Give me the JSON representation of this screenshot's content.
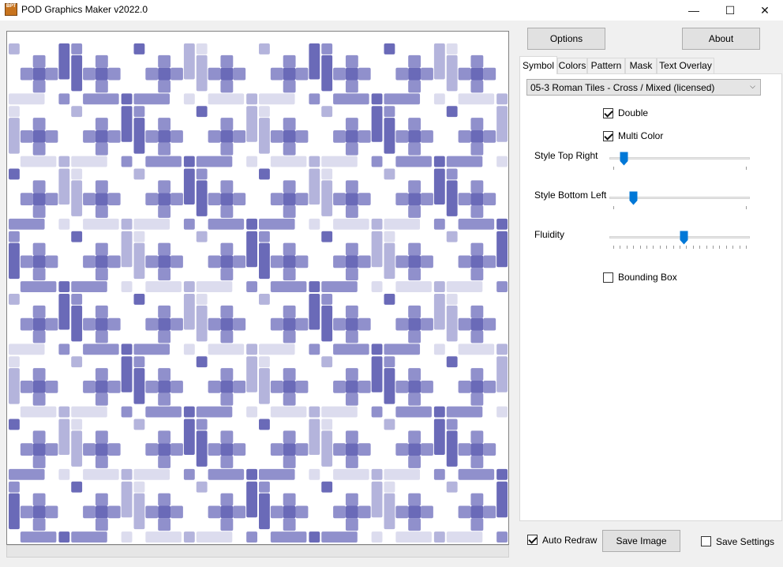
{
  "window": {
    "title": "POD Graphics Maker v2022.0",
    "app_icon_text": "BPT",
    "controls": {
      "minimize": "—",
      "maximize": "☐",
      "close": "✕"
    }
  },
  "toolbar": {
    "options_label": "Options",
    "about_label": "About"
  },
  "tabs": [
    {
      "label": "Symbol",
      "active": true
    },
    {
      "label": "Colors",
      "active": false
    },
    {
      "label": "Pattern",
      "active": false
    },
    {
      "label": "Mask",
      "active": false
    },
    {
      "label": "Text Overlay",
      "active": false
    }
  ],
  "symbol_tab": {
    "symbol_select": "05-3 Roman Tiles - Cross / Mixed (licensed)",
    "double": {
      "label": "Double",
      "checked": true
    },
    "multi_color": {
      "label": "Multi Color",
      "checked": true
    },
    "style_top_right": {
      "label": "Style Top Right",
      "value": 0.1
    },
    "style_bottom_left": {
      "label": "Style Bottom Left",
      "value": 0.17
    },
    "fluidity": {
      "label": "Fluidity",
      "value": 0.53
    },
    "bounding_box": {
      "label": "Bounding Box",
      "checked": false
    }
  },
  "footer": {
    "auto_redraw": {
      "label": "Auto Redraw",
      "checked": true
    },
    "save_image_label": "Save Image",
    "save_settings": {
      "label": "Save Settings",
      "checked": false
    }
  },
  "colors": {
    "pattern_light": "#dcdcee",
    "pattern_mid_light": "#b4b4dc",
    "pattern_mid": "#9090cc",
    "pattern_dark": "#6a6ab8",
    "slider_accent": "#0078d7"
  }
}
